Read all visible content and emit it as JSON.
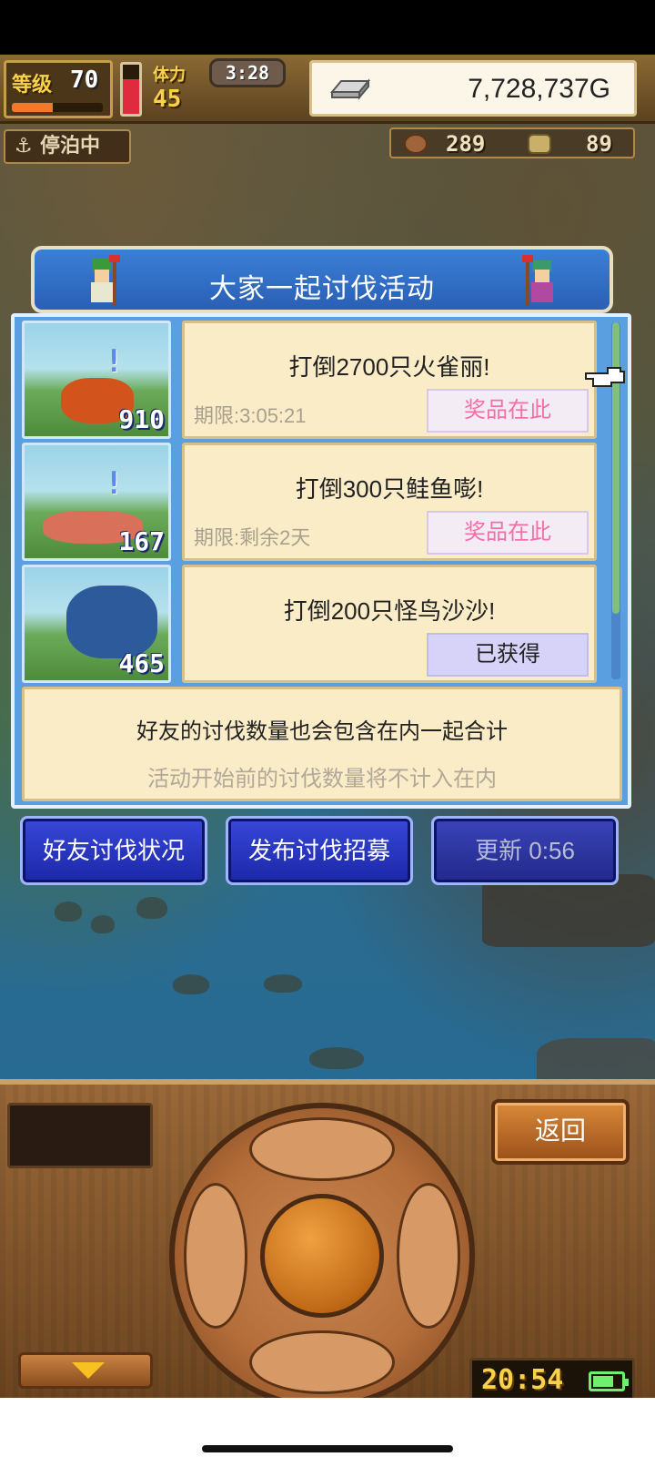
{
  "status": {
    "level_label": "等级",
    "level": "70",
    "xp_progress": 0.45,
    "hp_fraction": 0.7,
    "stamina_label": "体力",
    "stamina": "45",
    "timer": "3:28",
    "gold": "7,728,737G",
    "anchored": "停泊中",
    "resource1": "289",
    "resource2": "89"
  },
  "event": {
    "title": "大家一起讨伐活动",
    "quests": [
      {
        "count": "910",
        "mission": "打倒2700只火雀丽!",
        "deadline": "期限:3:05:21",
        "button": "奖品在此",
        "claimed": false,
        "monster_color": "#d2541c"
      },
      {
        "count": "167",
        "mission": "打倒300只鲑鱼嘭!",
        "deadline": "期限:剩余2天",
        "button": "奖品在此",
        "claimed": false,
        "monster_color": "#d8705a"
      },
      {
        "count": "465",
        "mission": "打倒200只怪鸟沙沙!",
        "deadline": "",
        "button": "已获得",
        "claimed": true,
        "monster_color": "#2c5a9a"
      }
    ],
    "notice_line1": "好友的讨伐数量也会包含在内一起合计",
    "notice_line2": "活动开始前的讨伐数量将不计入在内"
  },
  "actions": {
    "friend_status": "好友讨伐状况",
    "post_recruit": "发布讨伐招募",
    "refresh": "更新 0:56"
  },
  "controls": {
    "back": "返回",
    "clock": "20:54",
    "battery_fraction": 0.75
  },
  "colors": {
    "panel_blue": "#5aa0e0",
    "prize_pink": "#f070a8",
    "button_blue": "#1b27a8",
    "gold_text": "#f7d24a"
  }
}
